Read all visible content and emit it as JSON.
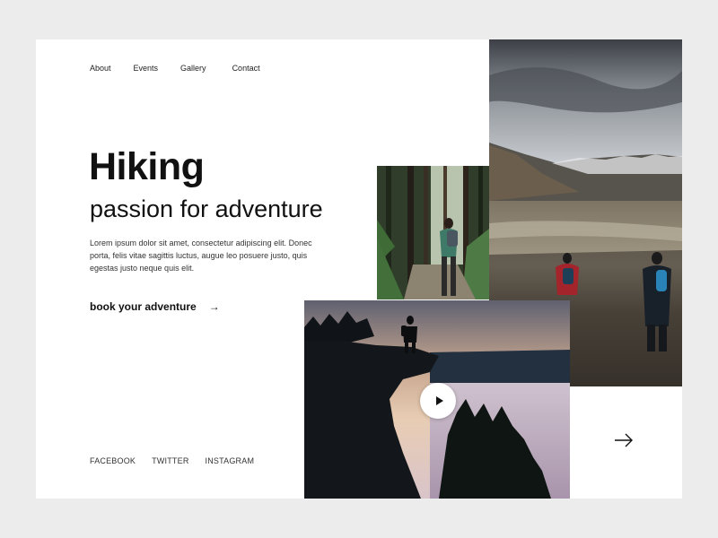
{
  "nav": {
    "items": [
      "About",
      "Events",
      "Gallery",
      "Contact"
    ]
  },
  "hero": {
    "title": "Hiking",
    "subtitle": "passion for adventure",
    "body": "Lorem ipsum dolor sit amet, consectetur adipiscing elit. Donec porta, felis vitae sagittis luctus, augue leo posuere justo, quis egestas justo neque quis elit.",
    "cta_label": "book your adventure",
    "cta_arrow": "→"
  },
  "social": {
    "items": [
      "FACEBOOK",
      "TWITTER",
      "INSTAGRAM"
    ]
  },
  "icons": {
    "cta": "arrow-right-icon",
    "play": "play-icon",
    "next": "arrow-right-icon"
  },
  "colors": {
    "background": "#ececec",
    "card": "#ffffff",
    "text": "#111111"
  }
}
